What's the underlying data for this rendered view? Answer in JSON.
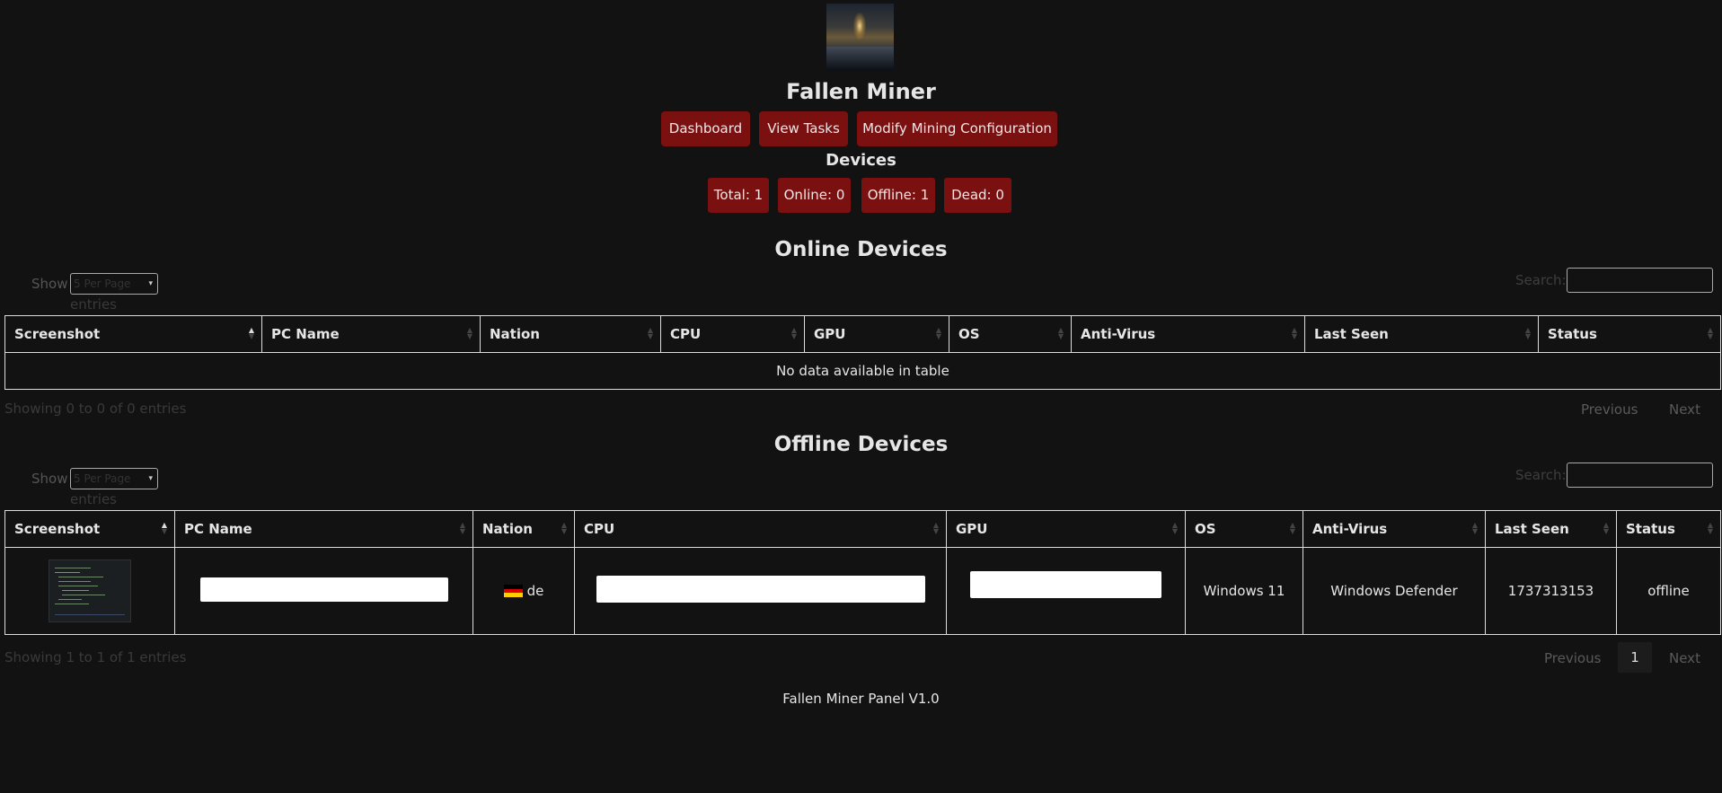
{
  "app": {
    "title": "Fallen Miner",
    "footer": "Fallen Miner Panel V1.0"
  },
  "nav": {
    "dashboard": "Dashboard",
    "view_tasks": "View Tasks",
    "modify_config": "Modify Mining Configuration"
  },
  "devices": {
    "heading": "Devices",
    "total": "Total: 1",
    "online": "Online: 0",
    "offline": "Offline: 1",
    "dead": "Dead: 0"
  },
  "colors": {
    "accent": "#7a1010",
    "background": "#121212"
  },
  "online_section": {
    "heading": "Online Devices",
    "show_label": "Show",
    "per_page": "5 Per Page",
    "entries_label": "entries",
    "search_label": "Search:",
    "columns": [
      "Screenshot",
      "PC Name",
      "Nation",
      "CPU",
      "GPU",
      "OS",
      "Anti-Virus",
      "Last Seen",
      "Status"
    ],
    "empty": "No data available in table",
    "info": "Showing 0 to 0 of 0 entries",
    "prev": "Previous",
    "next": "Next"
  },
  "offline_section": {
    "heading": "Offline Devices",
    "show_label": "Show",
    "per_page": "5 Per Page",
    "entries_label": "entries",
    "search_label": "Search:",
    "columns": [
      "Screenshot",
      "PC Name",
      "Nation",
      "CPU",
      "GPU",
      "OS",
      "Anti-Virus",
      "Last Seen",
      "Status"
    ],
    "rows": [
      {
        "nation": "de",
        "os": "Windows 11",
        "antivirus": "Windows Defender",
        "last_seen": "1737313153",
        "status": "offline"
      }
    ],
    "info": "Showing 1 to 1 of 1 entries",
    "prev": "Previous",
    "page": "1",
    "next": "Next"
  }
}
